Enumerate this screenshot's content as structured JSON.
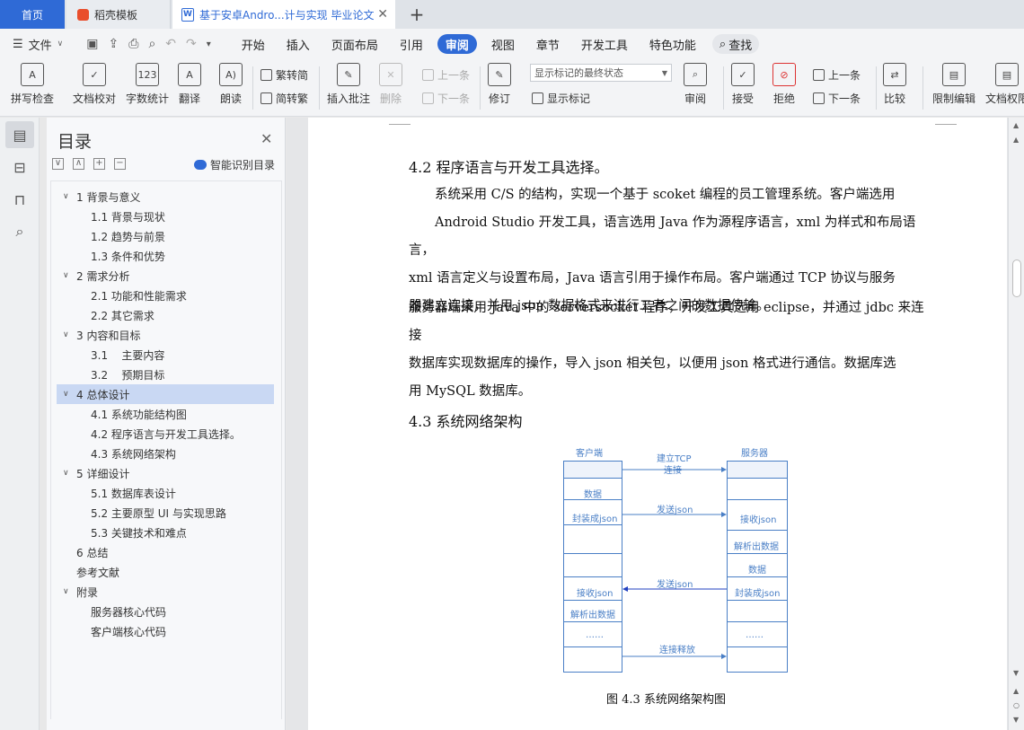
{
  "tabs": {
    "home": "首页",
    "templates": "稻壳模板",
    "document": "基于安卓Andro...计与实现 毕业论文"
  },
  "menubar": {
    "file": "文件",
    "tabs": [
      "开始",
      "插入",
      "页面布局",
      "引用",
      "审阅",
      "视图",
      "章节",
      "开发工具",
      "特色功能"
    ],
    "active_tab": "审阅",
    "search": "查找"
  },
  "ribbon": {
    "spell_check": "拼写检查",
    "doc_proofread": "文档校对",
    "word_count": "字数统计",
    "translate": "翻译",
    "read_aloud": "朗读",
    "to_traditional": "繁转简",
    "to_simplified": "简转繁",
    "insert_comment": "插入批注",
    "delete": "删除",
    "prev_comment": "上一条",
    "next_comment": "下一条",
    "revise": "修订",
    "markup_state": "显示标记的最终状态",
    "show_markup": "显示标记",
    "review": "审阅",
    "accept": "接受",
    "reject": "拒绝",
    "prev_change": "上一条",
    "next_change": "下一条",
    "compare": "比较",
    "restrict_edit": "限制编辑",
    "doc_permission": "文档权限"
  },
  "toc": {
    "title": "目录",
    "smart_toc": "智能识别目录",
    "items": [
      "1  背景与意义",
      "1.1  背景与现状",
      "1.2  趋势与前景",
      "1.3  条件和优势",
      "2  需求分析",
      "2.1  功能和性能需求",
      "2.2  其它需求",
      "3  内容和目标",
      "3.1    主要内容",
      "3.2    预期目标",
      "4  总体设计",
      "4.1 系统功能结构图",
      "4.2  程序语言与开发工具选择。",
      "4.3  系统网络架构",
      "5  详细设计",
      "5.1  数据库表设计",
      "5.2  主要原型 UI 与实现思路",
      "5.3  关键技术和难点",
      "6  总结",
      "参考文献",
      "附录",
      "服务器核心代码",
      "客户端核心代码"
    ]
  },
  "doc": {
    "heading_42": "4.2  程序语言与开发工具选择。",
    "para1_lines": [
      "系统采用 C/S 的结构，实现一个基于 scoket 编程的员工管理系统。客户端选用",
      "Android Studio 开发工具，语言选用 Java 作为源程序语言，xml 为样式和布局语言，",
      "xml 语言定义与设置布局，Java 语言引用于操作布局。客户端通过 TCP 协议与服务",
      "器建立连接，并用 json 数据格式来进行二者之间的数据传输。"
    ],
    "para2_lines": [
      "服务器端采用 Java 中的 serversocket 程序，开发工具选用 eclipse，并通过 jdbc 来连接",
      "数据库实现数据库的操作，导入 json 相关包，以便用 json 格式进行通信。数据库选",
      "用 MySQL 数据库。"
    ],
    "heading_43": "4.3  系统网络架构",
    "diagram": {
      "client_head": "客户端",
      "server_head": "服务器",
      "client_cells": [
        "数据",
        "封装成json",
        "接收json",
        "解析出数据",
        "……"
      ],
      "server_cells": [
        "接收json",
        "解析出数据",
        "数据",
        "封装成json",
        "……"
      ],
      "arrows": [
        "建立TCP",
        "连接",
        "发送json",
        "发送json",
        "连接释放"
      ]
    },
    "caption": "图 4.3  系统网络架构图"
  },
  "colors": {
    "accent": "#2f6ad6",
    "diagram": "#4a7fc6",
    "toc_selected": "#c9d8f3"
  }
}
